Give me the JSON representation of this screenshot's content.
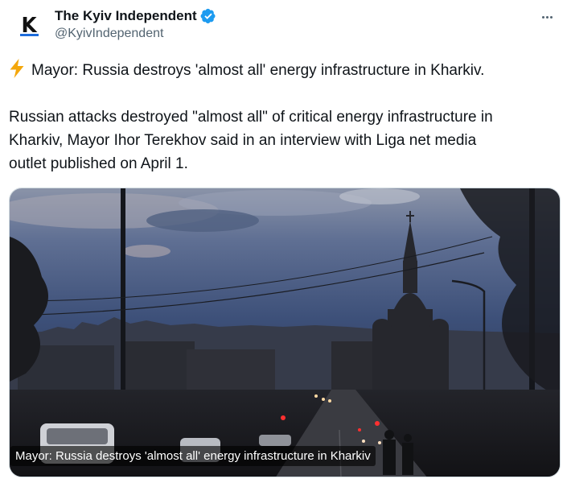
{
  "account": {
    "display_name": "The Kyiv Independent",
    "handle": "@KyivIndependent",
    "avatar_letter": "K",
    "verified_icon": "verified-badge-icon"
  },
  "menu": {
    "icon": "more-horizontal-icon"
  },
  "tweet": {
    "headline_icon": "lightning-icon",
    "headline": "Mayor: Russia destroys 'almost all' energy infrastructure in Kharkiv.",
    "body_lines": [
      "Russian attacks destroyed \"almost all\" of critical energy infrastructure in",
      "Kharkiv, Mayor Ihor Terekhov said in an interview with Liga net media",
      "outlet published on April 1."
    ]
  },
  "media": {
    "caption": "Mayor: Russia destroys 'almost all' energy infrastructure in Kharkiv"
  },
  "colors": {
    "text": "#0f1419",
    "secondary": "#536471",
    "verified": "#1d9bf0",
    "bolt": "#f4a70b"
  }
}
